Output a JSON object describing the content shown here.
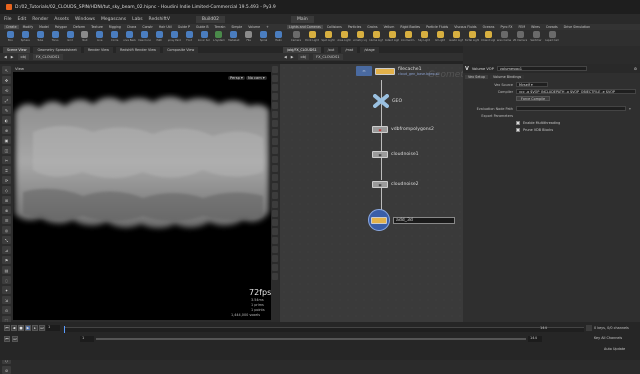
{
  "window": {
    "title": "D:/02_Tutorials/02_CLOUDS_SPIN/HDNI/tut_sky_beam_02.hipnc - Houdini Indie Limited-Commercial 19.5.493 - Py3.9"
  },
  "menu": {
    "items": [
      "File",
      "Edit",
      "Render",
      "Assets",
      "Windows",
      "Megascans",
      "Labs",
      "RedshiftV"
    ],
    "build_label": "Build02",
    "desk_label": "Main"
  },
  "shelf_tabs_left": [
    "Create",
    "Modify",
    "Model",
    "Polygon",
    "Deform",
    "Texture",
    "Rigging",
    "Chara",
    "Constr",
    "Hair Util",
    "Guide P",
    "Guide B",
    "Terrain",
    "Simple",
    "Volume",
    "+"
  ],
  "shelf_tabs_right": [
    "Lights and Cameras",
    "Collisions",
    "Particles",
    "Grains",
    "Vellum",
    "Rigid Bodies",
    "Particle Fluids",
    "Viscous Fluids",
    "Oceans",
    "Pyro FX",
    "FEM",
    "Wires",
    "Crowds",
    "Drive Simulation"
  ],
  "tools_left": [
    {
      "label": "Box",
      "color": "#4a7dbf"
    },
    {
      "label": "Sphere",
      "color": "#4a7dbf"
    },
    {
      "label": "Tube",
      "color": "#4a7dbf"
    },
    {
      "label": "Torus",
      "color": "#4a7dbf"
    },
    {
      "label": "Grid",
      "color": "#4a7dbf"
    },
    {
      "label": "Null",
      "color": "#8a8a8a"
    },
    {
      "label": "Line",
      "color": "#4a7dbf"
    },
    {
      "label": "Circle",
      "color": "#4a7dbf"
    },
    {
      "label": "Curve Bezier",
      "color": "#4a7dbf"
    },
    {
      "label": "Draw Curve",
      "color": "#4a7dbf"
    },
    {
      "label": "Path",
      "color": "#4a7dbf"
    },
    {
      "label": "Spray Paint",
      "color": "#4a7dbf"
    },
    {
      "label": "Font",
      "color": "#4a7dbf"
    },
    {
      "label": "Platonic Solids",
      "color": "#4a7dbf"
    },
    {
      "label": "L-System",
      "color": "#4a8a4a"
    },
    {
      "label": "Metaball",
      "color": "#4a7dbf"
    },
    {
      "label": "File",
      "color": "#8a8a8a"
    },
    {
      "label": "Spiral",
      "color": "#4a7dbf"
    },
    {
      "label": "Helix",
      "color": "#4a7dbf"
    }
  ],
  "tools_right": [
    {
      "label": "Camera",
      "color": "#6a6a6a"
    },
    {
      "label": "Point Light",
      "color": "#d8b040"
    },
    {
      "label": "Spot Light",
      "color": "#d8b040"
    },
    {
      "label": "Area Light",
      "color": "#d8b040"
    },
    {
      "label": "Geometry Light",
      "color": "#d8b040"
    },
    {
      "label": "Volume Light",
      "color": "#d8b040"
    },
    {
      "label": "Distant Light",
      "color": "#d8b040"
    },
    {
      "label": "Environment Light",
      "color": "#d8b040"
    },
    {
      "label": "Sky Light",
      "color": "#d8b040"
    },
    {
      "label": "GI Light",
      "color": "#d8b040"
    },
    {
      "label": "Caustic Light",
      "color": "#d8b040"
    },
    {
      "label": "Portal Light",
      "color": "#d8b040"
    },
    {
      "label": "Ambient Light",
      "color": "#d8b040"
    },
    {
      "label": "Stereo Camera",
      "color": "#6a6a6a"
    },
    {
      "label": "VR Camera",
      "color": "#6a6a6a"
    },
    {
      "label": "Switcher",
      "color": "#6a6a6a"
    },
    {
      "label": "Gamepad Camera",
      "color": "#6a6a6a"
    }
  ],
  "left_pane": {
    "tabs": [
      "Scene View",
      "Geometry Spreadsheet",
      "Render View",
      "Redshift Render View",
      "Composite View"
    ],
    "path_obj": "obj",
    "path_node": "FX_CLOUDS1"
  },
  "viewport": {
    "label": "View",
    "persp": "Persp",
    "cam": "No cam",
    "fps": "72fps",
    "fps_time": "3.54ms",
    "stats": [
      "1 prims",
      "1 points",
      "1,444,000 voxels"
    ]
  },
  "network": {
    "tabs": [
      "/obj/FX_CLOUDS1",
      "/out",
      "/mat",
      "/stage"
    ],
    "path_obj": "obj",
    "path_node": "FX_CLOUDS1",
    "watermark": "Geometry",
    "nodes": {
      "filecache": "filecache1",
      "filecache_sub": "cloud_gen_base.bgeo.sc",
      "geo": "GEO",
      "vdb": "vdbfrompolygons2",
      "cn1": "cloudnoise1",
      "cn2": "cloudnoise2",
      "add3d": "add_3d"
    }
  },
  "params": {
    "node_type": "Volume VOP",
    "node_name": "volumevop1",
    "tabs": [
      "Vex Setup",
      "Volume Bindings"
    ],
    "vex_source_label": "Vex Source",
    "vex_source_value": "Myself",
    "compiler_label": "Compiler",
    "compiler_value": "vcc -q $VOP_INCLUDEPATH -o $VOP_OBJECTFILE -e $VOP_",
    "force_compile": "Force Compile",
    "eval_label": "Evaluation Node Path",
    "export_label": "Export Parameters",
    "multithreading": "Enable Multithreading",
    "prune_vdb": "Prune VDB Blocks"
  },
  "timeline": {
    "frame": "1",
    "start": "1",
    "end_a": "144",
    "end_b": "144",
    "keys_label": "0 keys, 0/0 channels",
    "key_all": "Key All Channels",
    "auto_update": "Auto Update"
  }
}
